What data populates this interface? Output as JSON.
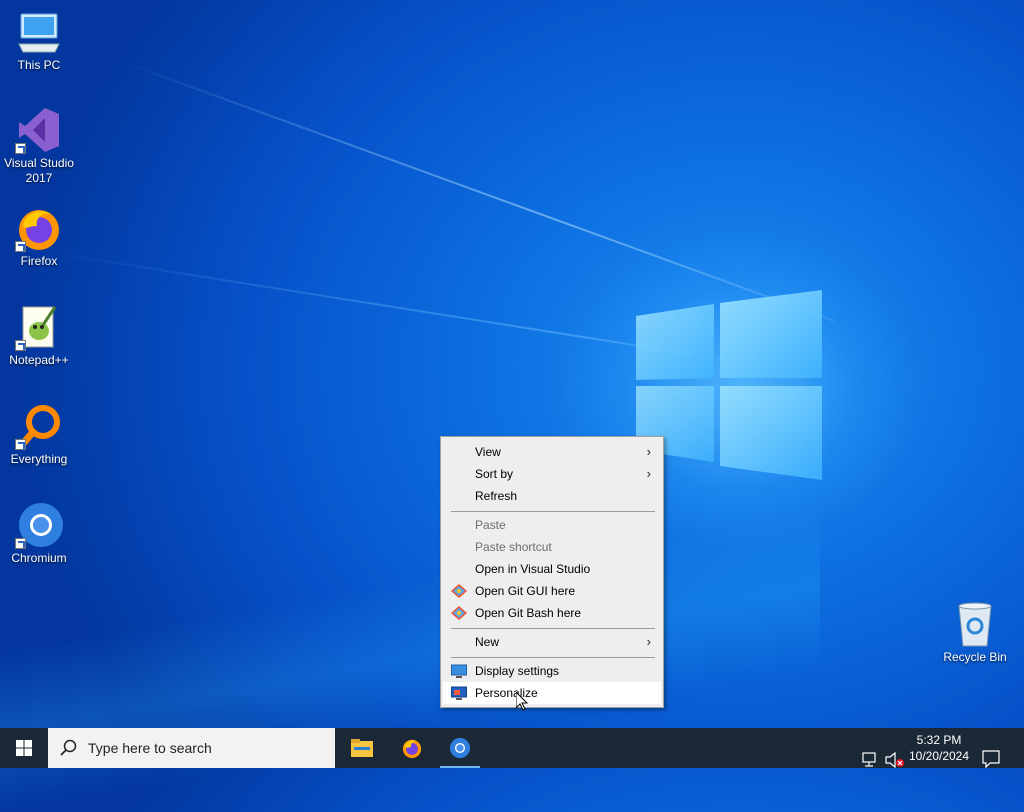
{
  "desktop": {
    "icons": [
      {
        "label": "This PC",
        "icon": "this-pc-icon"
      },
      {
        "label": "Visual Studio 2017",
        "icon": "visual-studio-icon"
      },
      {
        "label": "Firefox",
        "icon": "firefox-icon"
      },
      {
        "label": "Notepad++",
        "icon": "notepadpp-icon"
      },
      {
        "label": "Everything",
        "icon": "everything-search-icon"
      },
      {
        "label": "Chromium",
        "icon": "chromium-icon"
      },
      {
        "label": "Recycle Bin",
        "icon": "recycle-bin-icon"
      }
    ]
  },
  "context_menu": {
    "items": [
      {
        "label": "View",
        "submenu": true,
        "enabled": true
      },
      {
        "label": "Sort by",
        "submenu": true,
        "enabled": true
      },
      {
        "label": "Refresh",
        "enabled": true
      },
      {
        "label": "Paste",
        "enabled": false
      },
      {
        "label": "Paste shortcut",
        "enabled": false
      },
      {
        "label": "Open in Visual Studio",
        "enabled": true
      },
      {
        "label": "Open Git GUI here",
        "enabled": true,
        "icon": "git-icon"
      },
      {
        "label": "Open Git Bash here",
        "enabled": true,
        "icon": "git-icon"
      },
      {
        "label": "New",
        "submenu": true,
        "enabled": true
      },
      {
        "label": "Display settings",
        "enabled": true,
        "icon": "display-icon"
      },
      {
        "label": "Personalize",
        "enabled": true,
        "icon": "personalize-icon",
        "hovered": true
      }
    ],
    "submenu_glyph": "›"
  },
  "taskbar": {
    "search_placeholder": "Type here to search",
    "pinned": [
      "file-explorer-icon",
      "firefox-icon",
      "chromium-icon"
    ],
    "clock": {
      "time": "5:32 PM",
      "date": "10/20/2024"
    }
  },
  "colors": {
    "taskbar": "#1b2836",
    "menu_bg": "#eeeeee",
    "accent": "#0078d7"
  }
}
